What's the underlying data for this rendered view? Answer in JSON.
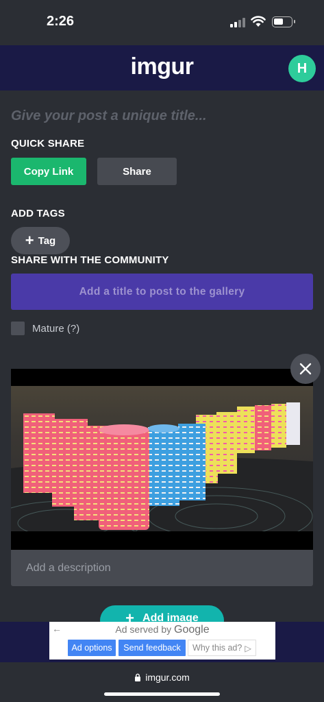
{
  "status_bar": {
    "time": "2:26"
  },
  "header": {
    "logo": "imgur",
    "avatar_letter": "H",
    "avatar_color": "#2ecc9b"
  },
  "post": {
    "title_placeholder": "Give your post a unique title..."
  },
  "quick_share": {
    "label": "QUICK SHARE",
    "copy_link": "Copy Link",
    "share": "Share"
  },
  "tags": {
    "label": "ADD TAGS",
    "tag_button": "Tag"
  },
  "community": {
    "label": "SHARE WITH THE COMMUNITY",
    "gallery_button": "Add a title to post to the gallery",
    "mature_label": "Mature (?)"
  },
  "image": {
    "description_placeholder": "Add a description"
  },
  "add_image": {
    "label": "Add image"
  },
  "ad": {
    "served_by": "Ad served by",
    "brand": "Google",
    "options": "Ad options",
    "feedback": "Send feedback",
    "why": "Why this ad?"
  },
  "browser": {
    "url": "imgur.com"
  },
  "colors": {
    "header_bg": "#1a1a46",
    "page_bg": "#2b2e34",
    "copy_link_green": "#1bb76e",
    "gallery_purple": "#4a3aa8",
    "add_image_teal": "#12b4ad"
  }
}
